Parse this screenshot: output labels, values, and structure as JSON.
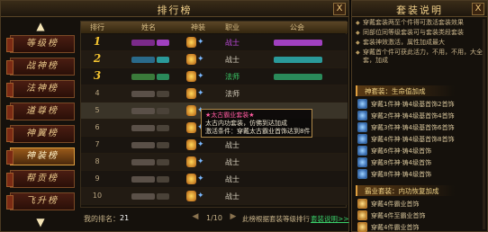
{
  "ranking_window": {
    "title": "排行榜",
    "close_label": "X",
    "nav": {
      "up_arrow": "▲",
      "down_arrow": "▼",
      "items": [
        "等级榜",
        "战神榜",
        "法神榜",
        "道尊榜",
        "神翼榜",
        "神装榜",
        "帮贡榜",
        "飞升榜"
      ],
      "active_index": 5
    },
    "table": {
      "headers": [
        "排行",
        "姓名",
        "神装",
        "职业",
        "公会"
      ],
      "rows": [
        {
          "rank": "1",
          "job": "战士",
          "job_color": "#c04adf"
        },
        {
          "rank": "2",
          "job": "战士",
          "job_color": "#d9d2c0"
        },
        {
          "rank": "3",
          "job": "法师",
          "job_color": "#3ad06a"
        },
        {
          "rank": "4",
          "job": "法师",
          "job_color": "#d9d2c0"
        },
        {
          "rank": "5",
          "job": "",
          "job_color": "#d9d2c0"
        },
        {
          "rank": "6",
          "job": "",
          "job_color": "#d9d2c0"
        },
        {
          "rank": "7",
          "job": "战士",
          "job_color": "#d9d2c0"
        },
        {
          "rank": "8",
          "job": "战士",
          "job_color": "#d9d2c0"
        },
        {
          "rank": "9",
          "job": "战士",
          "job_color": "#d9d2c0"
        },
        {
          "rank": "10",
          "job": "战士",
          "job_color": "#d9d2c0"
        }
      ],
      "selected_index": 4
    },
    "tooltip": {
      "line1": "★太古霸业套装★",
      "line2": "太古内功套装，仿佛到达加成",
      "line3": "激活条件：穿戴太古霸业首饰达到8件"
    },
    "footer": {
      "my_rank_label": "我的排名：",
      "my_rank_value": "21",
      "prev": "◀",
      "page": "1/10",
      "next": "▶",
      "hint": "此榜根据套装等级排行",
      "help_link": "套装说明>>"
    }
  },
  "info_window": {
    "title": "套装说明",
    "close_label": "X",
    "notes": [
      "穿戴套装两至个件得可激活套装效果",
      "同部位同等级套装可与套装类段套装",
      "套装神效激活，属性加成最大",
      "穿戴首个件可获此活力，不用，不用，大全套，加成"
    ],
    "sections": [
      {
        "title": "神套装：生命值加成",
        "icon": "blue",
        "items": [
          "穿戴1件神·铸4级基首饰2首饰",
          "穿戴2件神·铸4级基首饰4首饰",
          "穿戴3件神·铸4级基首饰6首饰",
          "穿戴4件神·铸4级基首饰8首饰",
          "穿戴6件神·铸4级首饰",
          "穿戴8件神·铸4级首饰",
          "穿戴8件神·铸4级首饰"
        ]
      },
      {
        "title": "霸业套装：内功恢复加成",
        "icon": "gold",
        "items": [
          "穿戴4件霸业首饰",
          "穿戴4件至霸业首饰",
          "穿戴4件霸业首饰"
        ]
      }
    ]
  },
  "colors": {
    "gold": "#f2c230",
    "accent_green": "#3ad06a",
    "tooltip_title": "#ff5aa0"
  }
}
